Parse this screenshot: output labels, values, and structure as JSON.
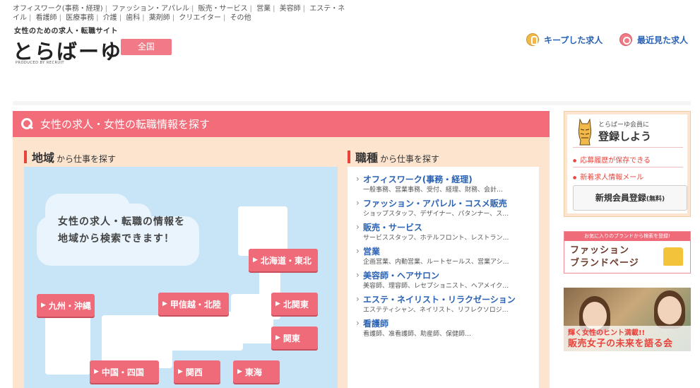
{
  "header": {
    "categories": [
      "オフィスワーク(事務・経理)",
      "ファッション・アパレル",
      "販売・サービス",
      "営業",
      "美容師",
      "エステ・ネイル",
      "看護師",
      "医療事務",
      "介護",
      "歯科",
      "薬剤師",
      "クリエイター",
      "その他"
    ],
    "tagline": "女性のための求人・転職サイト",
    "logo": "とらばーゆ",
    "produced_by": "PRODUCED BY RECRUIT",
    "region_button": "全国",
    "kept_jobs": "キープした求人",
    "recent_jobs": "最近見た求人"
  },
  "search_panel": {
    "title": "女性の求人・女性の転職情報を探す",
    "region_section": {
      "title": "地域",
      "sub": "から仕事を探す"
    },
    "job_section": {
      "title": "職種",
      "sub": "から仕事を探す"
    },
    "map_text_line1": "女性の求人・転職の情報を",
    "map_text_line2": "地域から検索できます！",
    "regions": {
      "hokkaido": "北海道・東北",
      "kyushu": "九州・沖縄",
      "koshinetsu": "甲信越・北陸",
      "kitakanto": "北関東",
      "kanto": "関東",
      "chugoku": "中国・四国",
      "kansai": "関西",
      "tokai": "東海"
    },
    "jobs": [
      {
        "title": "オフィスワーク(事務・経理)",
        "desc": "一般事務、営業事務、受付、経理、財務、会計…"
      },
      {
        "title": "ファッション・アパレル・コスメ販売",
        "desc": "ショップスタッフ、デザイナー、パタンナー、ス…"
      },
      {
        "title": "販売・サービス",
        "desc": "サービススタッフ、ホテルフロント、レストラン…"
      },
      {
        "title": "営業",
        "desc": "企画営業、内勤営業、ルートセールス、営業アシ…"
      },
      {
        "title": "美容師・ヘアサロン",
        "desc": "美容師、理容師、レセプショニスト、ヘアメイク…"
      },
      {
        "title": "エステ・ネイリスト・リラクゼーション",
        "desc": "エステティシャン、ネイリスト、リフレクソロジ…"
      },
      {
        "title": "看護師",
        "desc": "看護師、准看護師、助産師、保健師…"
      }
    ]
  },
  "sidebar": {
    "reg_small": "とらばーゆ会員に",
    "reg_big": "登録しよう",
    "reg_item1": "応募履歴が保存できる",
    "reg_item2": "新着求人情報メール",
    "reg_button": "新規会員登録",
    "reg_button_note": "(無料)",
    "brand_strip": "お気に入りのブランドから検索を登録!",
    "brand_line1": "ファッション",
    "brand_line2": "ブランドページ",
    "feature_line1": "輝く女性のヒント満載!!",
    "feature_line2": "販売女子の未来を語る会"
  }
}
